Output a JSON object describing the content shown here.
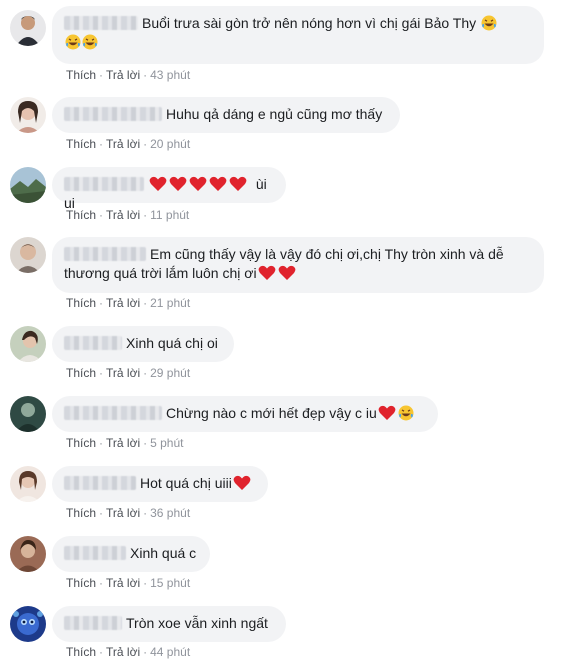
{
  "actions": {
    "like_label": "Thích",
    "reply_label": "Trả lời",
    "separator": "·"
  },
  "comments": [
    {
      "name_blur_width": 74,
      "text": "Buổi trưa sài gòn trở nên nóng hơn vì chị gái Bảo Thy",
      "text2": "",
      "time": "43 phút",
      "avatar_color": "#3a3f4a",
      "avatar_fg": "#d9c1a7"
    },
    {
      "name_blur_width": 98,
      "text": "Huhu qả dáng e ngủ cũng mơ thấy",
      "text2": "",
      "time": "20 phút",
      "avatar_color": "#c9a79a",
      "avatar_fg": "#ead7cf"
    },
    {
      "name_blur_width": 80,
      "text": "ùi ui",
      "text2": "",
      "time": "11 phút",
      "avatar_color": "#7a9bb0",
      "avatar_fg": "#4e6c4a"
    },
    {
      "name_blur_width": 82,
      "text": "Em cũng thấy vậy là vậy đó chị ơi,chị Thy tròn xinh và dễ",
      "text2": "thương quá trời lắm luôn chị ơi",
      "time": "21 phút",
      "avatar_color": "#d8d2cc",
      "avatar_fg": "#6a6058"
    },
    {
      "name_blur_width": 58,
      "text": "Xinh quá chị oi",
      "text2": "",
      "time": "29 phút",
      "avatar_color": "#a9b7a0",
      "avatar_fg": "#5b4a3d"
    },
    {
      "name_blur_width": 98,
      "text": "Chừng nào c mới hết đẹp vậy c iu",
      "text2": "",
      "time": "5 phút",
      "avatar_color": "#2f4a44",
      "avatar_fg": "#8fa89a"
    },
    {
      "name_blur_width": 72,
      "text": "Hot quá chị uiii",
      "text2": "",
      "time": "36 phút",
      "avatar_color": "#e2cfc6",
      "avatar_fg": "#8a6a58"
    },
    {
      "name_blur_width": 62,
      "text": "Xinh quá c",
      "text2": "",
      "time": "15 phút",
      "avatar_color": "#9a6a55",
      "avatar_fg": "#d7b49a"
    },
    {
      "name_blur_width": 58,
      "text": "Tròn xoe vẫn xinh ngất",
      "text2": "",
      "time": "44 phút",
      "avatar_color": "#1d3a8a",
      "avatar_fg": "#5fa0e0"
    }
  ]
}
